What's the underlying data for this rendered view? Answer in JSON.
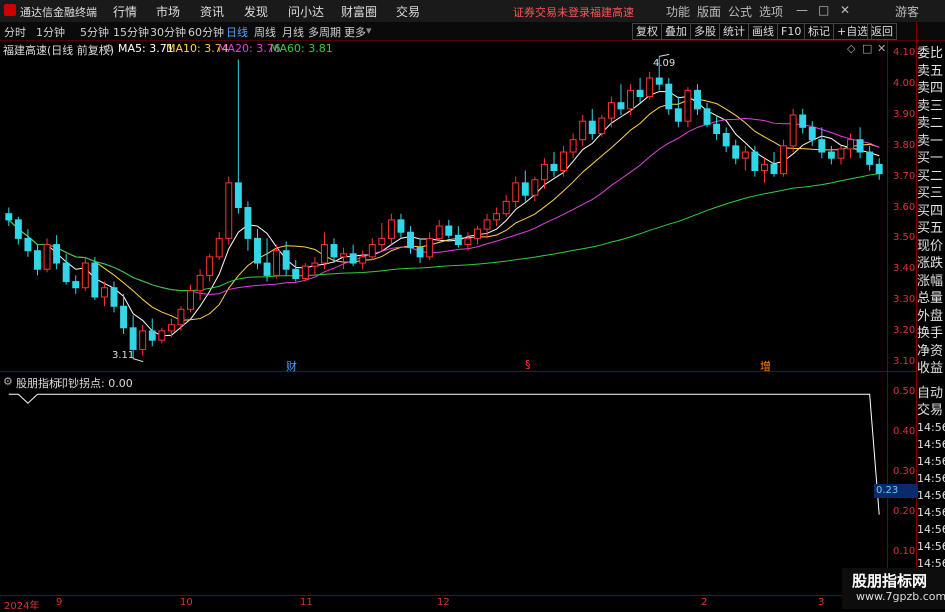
{
  "app": {
    "title": "通达信金融终端"
  },
  "menu": [
    "行情",
    "市场",
    "资讯",
    "发现",
    "问小达",
    "财富圈",
    "交易"
  ],
  "status": {
    "login": "证券交易未登录",
    "stock": "福建高速"
  },
  "window_menu": [
    "功能",
    "版面",
    "公式",
    "选项"
  ],
  "window_controls": [
    "—",
    "□",
    "✕"
  ],
  "user": "游客",
  "timeframes": [
    "分时",
    "1分钟",
    "5分钟",
    "15分钟",
    "30分钟",
    "60分钟",
    "日线",
    "周线",
    "月线",
    "多周期",
    "更多"
  ],
  "timeframes_active": "日线",
  "toolbar_right": [
    "复权",
    "叠加",
    "多股",
    "统计",
    "画线",
    "F10",
    "标记",
    "+自选",
    "返回"
  ],
  "stock_header": {
    "name": "福建高速(日线 前复权)"
  },
  "ma": [
    {
      "label": "MA5: 3.71",
      "color": "#ffffff"
    },
    {
      "label": "MA10: 3.74",
      "color": "#ffd24a"
    },
    {
      "label": "MA20: 3.76",
      "color": "#e040e0"
    },
    {
      "label": "MA60: 3.81",
      "color": "#30d040"
    }
  ],
  "price_axis": [
    "4.10",
    "4.00",
    "3.90",
    "3.80",
    "3.70",
    "3.60",
    "3.50",
    "3.40",
    "3.30",
    "3.20",
    "3.10"
  ],
  "price_marks": {
    "high": "4.09",
    "low": "3.11"
  },
  "event_marks": [
    "财",
    "§",
    "增"
  ],
  "indicator": {
    "name": "股朋指标",
    "formula": "印钞拐点: 0.00",
    "current": "0.23"
  },
  "ind_axis": [
    "0.50",
    "0.40",
    "0.30",
    "0.20",
    "0.10"
  ],
  "right_panel": [
    "委比",
    "卖五",
    "卖四",
    "卖三",
    "卖二",
    "卖一",
    "买一",
    "买二",
    "买三",
    "买四",
    "买五",
    "现价",
    "涨跌",
    "涨幅",
    "总量",
    "外盘",
    "换手",
    "净资",
    "收益"
  ],
  "right_panel_lower": [
    "自动",
    "交易",
    "14:56",
    "14:56",
    "14:56",
    "14:56",
    "14:56",
    "14:56",
    "14:56",
    "14:56",
    "14:56",
    "14:56"
  ],
  "x_axis": [
    "2024年",
    "9",
    "10",
    "11",
    "12",
    "2",
    "3"
  ],
  "watermark": {
    "title": "股朋指标网",
    "url": "www.7gpzb.com"
  },
  "chart_data": {
    "type": "candlestick",
    "y_range": [
      3.07,
      4.14
    ],
    "ma_values": {
      "MA5": 3.71,
      "MA10": 3.74,
      "MA20": 3.76,
      "MA60": 3.81
    },
    "candles": [
      [
        3.58,
        3.6,
        3.54,
        3.56
      ],
      [
        3.56,
        3.57,
        3.48,
        3.5
      ],
      [
        3.5,
        3.53,
        3.44,
        3.46
      ],
      [
        3.46,
        3.48,
        3.38,
        3.4
      ],
      [
        3.4,
        3.5,
        3.39,
        3.48
      ],
      [
        3.48,
        3.51,
        3.4,
        3.42
      ],
      [
        3.42,
        3.45,
        3.35,
        3.36
      ],
      [
        3.36,
        3.38,
        3.32,
        3.34
      ],
      [
        3.34,
        3.44,
        3.33,
        3.42
      ],
      [
        3.42,
        3.44,
        3.3,
        3.31
      ],
      [
        3.31,
        3.36,
        3.28,
        3.34
      ],
      [
        3.34,
        3.36,
        3.26,
        3.28
      ],
      [
        3.28,
        3.32,
        3.19,
        3.21
      ],
      [
        3.21,
        3.25,
        3.11,
        3.14
      ],
      [
        3.14,
        3.22,
        3.12,
        3.2
      ],
      [
        3.2,
        3.24,
        3.15,
        3.17
      ],
      [
        3.17,
        3.21,
        3.16,
        3.2
      ],
      [
        3.2,
        3.24,
        3.18,
        3.22
      ],
      [
        3.22,
        3.28,
        3.2,
        3.27
      ],
      [
        3.27,
        3.35,
        3.26,
        3.33
      ],
      [
        3.33,
        3.4,
        3.3,
        3.38
      ],
      [
        3.38,
        3.45,
        3.36,
        3.44
      ],
      [
        3.44,
        3.52,
        3.43,
        3.5
      ],
      [
        3.5,
        3.7,
        3.48,
        3.68
      ],
      [
        3.68,
        4.08,
        3.58,
        3.6
      ],
      [
        3.6,
        3.62,
        3.46,
        3.5
      ],
      [
        3.5,
        3.53,
        3.4,
        3.42
      ],
      [
        3.42,
        3.5,
        3.36,
        3.38
      ],
      [
        3.38,
        3.48,
        3.37,
        3.46
      ],
      [
        3.46,
        3.49,
        3.38,
        3.4
      ],
      [
        3.4,
        3.43,
        3.36,
        3.37
      ],
      [
        3.37,
        3.42,
        3.36,
        3.41
      ],
      [
        3.41,
        3.44,
        3.38,
        3.42
      ],
      [
        3.42,
        3.52,
        3.4,
        3.48
      ],
      [
        3.48,
        3.5,
        3.42,
        3.44
      ],
      [
        3.44,
        3.47,
        3.4,
        3.45
      ],
      [
        3.45,
        3.48,
        3.41,
        3.42
      ],
      [
        3.42,
        3.46,
        3.4,
        3.44
      ],
      [
        3.44,
        3.5,
        3.43,
        3.48
      ],
      [
        3.48,
        3.55,
        3.46,
        3.5
      ],
      [
        3.5,
        3.58,
        3.48,
        3.56
      ],
      [
        3.56,
        3.58,
        3.5,
        3.52
      ],
      [
        3.52,
        3.54,
        3.45,
        3.47
      ],
      [
        3.47,
        3.5,
        3.42,
        3.44
      ],
      [
        3.44,
        3.52,
        3.43,
        3.5
      ],
      [
        3.5,
        3.56,
        3.49,
        3.54
      ],
      [
        3.54,
        3.56,
        3.5,
        3.51
      ],
      [
        3.51,
        3.54,
        3.47,
        3.48
      ],
      [
        3.48,
        3.52,
        3.46,
        3.5
      ],
      [
        3.5,
        3.54,
        3.48,
        3.53
      ],
      [
        3.53,
        3.58,
        3.5,
        3.56
      ],
      [
        3.56,
        3.6,
        3.54,
        3.58
      ],
      [
        3.58,
        3.64,
        3.57,
        3.62
      ],
      [
        3.62,
        3.7,
        3.6,
        3.68
      ],
      [
        3.68,
        3.72,
        3.62,
        3.64
      ],
      [
        3.64,
        3.7,
        3.62,
        3.69
      ],
      [
        3.69,
        3.76,
        3.66,
        3.74
      ],
      [
        3.74,
        3.78,
        3.7,
        3.72
      ],
      [
        3.72,
        3.8,
        3.7,
        3.78
      ],
      [
        3.78,
        3.84,
        3.76,
        3.82
      ],
      [
        3.82,
        3.9,
        3.8,
        3.88
      ],
      [
        3.88,
        3.92,
        3.82,
        3.84
      ],
      [
        3.84,
        3.9,
        3.83,
        3.89
      ],
      [
        3.89,
        3.96,
        3.86,
        3.94
      ],
      [
        3.94,
        4.0,
        3.9,
        3.92
      ],
      [
        3.92,
        4.0,
        3.9,
        3.98
      ],
      [
        3.98,
        4.02,
        3.94,
        3.96
      ],
      [
        3.96,
        4.04,
        3.95,
        4.02
      ],
      [
        4.02,
        4.09,
        3.98,
        4.0
      ],
      [
        4.0,
        4.02,
        3.9,
        3.92
      ],
      [
        3.92,
        3.96,
        3.86,
        3.88
      ],
      [
        3.88,
        3.99,
        3.86,
        3.98
      ],
      [
        3.98,
        4.0,
        3.9,
        3.92
      ],
      [
        3.92,
        3.94,
        3.86,
        3.87
      ],
      [
        3.87,
        3.9,
        3.82,
        3.84
      ],
      [
        3.84,
        3.86,
        3.78,
        3.8
      ],
      [
        3.8,
        3.82,
        3.74,
        3.76
      ],
      [
        3.76,
        3.8,
        3.72,
        3.78
      ],
      [
        3.78,
        3.8,
        3.7,
        3.72
      ],
      [
        3.72,
        3.76,
        3.68,
        3.74
      ],
      [
        3.74,
        3.78,
        3.7,
        3.71
      ],
      [
        3.71,
        3.82,
        3.7,
        3.8
      ],
      [
        3.8,
        3.92,
        3.78,
        3.9
      ],
      [
        3.9,
        3.92,
        3.84,
        3.86
      ],
      [
        3.86,
        3.88,
        3.8,
        3.82
      ],
      [
        3.82,
        3.86,
        3.76,
        3.78
      ],
      [
        3.78,
        3.8,
        3.74,
        3.76
      ],
      [
        3.76,
        3.8,
        3.74,
        3.79
      ],
      [
        3.79,
        3.84,
        3.76,
        3.82
      ],
      [
        3.82,
        3.86,
        3.76,
        3.78
      ],
      [
        3.78,
        3.8,
        3.72,
        3.74
      ],
      [
        3.74,
        3.76,
        3.69,
        3.71
      ]
    ],
    "indicator_series": [
      0.5,
      0.5,
      0.48,
      0.5,
      0.5,
      0.5,
      0.5,
      0.5,
      0.5,
      0.5,
      0.5,
      0.5,
      0.5,
      0.5,
      0.5,
      0.5,
      0.5,
      0.5,
      0.5,
      0.5,
      0.5,
      0.5,
      0.5,
      0.5,
      0.5,
      0.5,
      0.5,
      0.5,
      0.5,
      0.5,
      0.5,
      0.5,
      0.5,
      0.5,
      0.5,
      0.5,
      0.5,
      0.5,
      0.5,
      0.5,
      0.5,
      0.5,
      0.5,
      0.5,
      0.5,
      0.5,
      0.5,
      0.5,
      0.5,
      0.5,
      0.5,
      0.5,
      0.5,
      0.5,
      0.5,
      0.5,
      0.5,
      0.5,
      0.5,
      0.5,
      0.5,
      0.5,
      0.5,
      0.5,
      0.5,
      0.5,
      0.5,
      0.5,
      0.5,
      0.5,
      0.5,
      0.5,
      0.5,
      0.5,
      0.5,
      0.5,
      0.5,
      0.5,
      0.5,
      0.5,
      0.5,
      0.5,
      0.5,
      0.5,
      0.5,
      0.5,
      0.5,
      0.5,
      0.5,
      0.5,
      0.5,
      0.23
    ]
  }
}
